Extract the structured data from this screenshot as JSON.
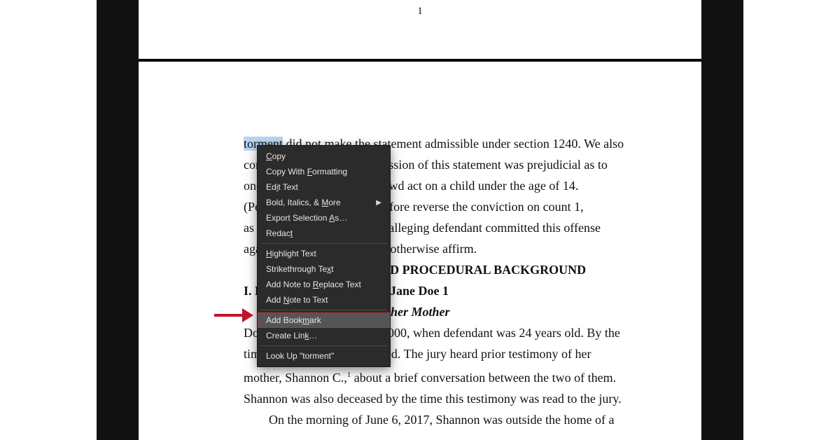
{
  "page_number": "1",
  "selected_word": "torment",
  "document": {
    "line1_before_sel": "",
    "line1_after_sel": " did not make the statement admissible under section 1240.  We also",
    "line2": "conclude the erroneous admission of this statement was prejudicial as to",
    "line3": "one count of committing a lewd act on a child under the age of 14.",
    "line4_prefix": "(Pen. Code, § 288.)",
    "line4_rest": "  We therefore reverse the conviction on count 1,",
    "line5": "as well as the enhancements alleging defendant committed this offense",
    "line6": "against multiple victims, but otherwise affirm.",
    "heading_bg": "FACTUAL AND PROCEDURAL BACKGROUND",
    "heading_I": "I.  Foundational Facts as to Jane Doe 1",
    "heading_A": "A.  Doe 1's Statement to her Mother",
    "p2_line1": "Doe 1 was born in January 2000, when defendant was 24 years old.  By the",
    "p2_line2": "time of trial, she was deceased.  The jury heard prior testimony of her",
    "p2_line3a": "mother, Shannon C.,",
    "p2_sup": "1",
    "p2_line3b": " about a brief conversation between the two of them.",
    "p2_line4": "Shannon was also deceased by the time this testimony was read to the jury.",
    "p3_line1": "On the morning of June 6, 2017, Shannon was outside the home of a"
  },
  "context_menu": {
    "items": [
      {
        "label": "Copy",
        "u": "C",
        "rest": "opy"
      },
      {
        "label": "Copy With Formatting",
        "plain_pre": "Copy With ",
        "u": "F",
        "rest": "ormatting"
      },
      {
        "plain_pre": "Ed",
        "u": "i",
        "rest": "t Text"
      },
      {
        "plain_pre": "Bold, Italics, & ",
        "u": "M",
        "rest": "ore",
        "submenu": true
      },
      {
        "plain_pre": "Export Selection ",
        "u": "A",
        "rest": "s…"
      },
      {
        "plain_pre": "Redac",
        "u": "t",
        "rest": ""
      },
      {
        "sep": true
      },
      {
        "u": "H",
        "rest": "ighlight Text"
      },
      {
        "plain_pre": "Strikethrough Te",
        "u": "x",
        "rest": "t"
      },
      {
        "plain_pre": "Add Note to ",
        "u": "R",
        "rest": "eplace Text"
      },
      {
        "plain_pre": "Add ",
        "u": "N",
        "rest": "ote to Text"
      },
      {
        "sep": true
      },
      {
        "plain_pre": "Add Book",
        "u": "m",
        "rest": "ark",
        "hovered": true,
        "anno": true
      },
      {
        "plain_pre": "Create Lin",
        "u": "k",
        "rest": "…"
      },
      {
        "sep": true
      },
      {
        "plain_pre": "Look Up \"torment\"",
        "u": "",
        "rest": ""
      }
    ]
  }
}
